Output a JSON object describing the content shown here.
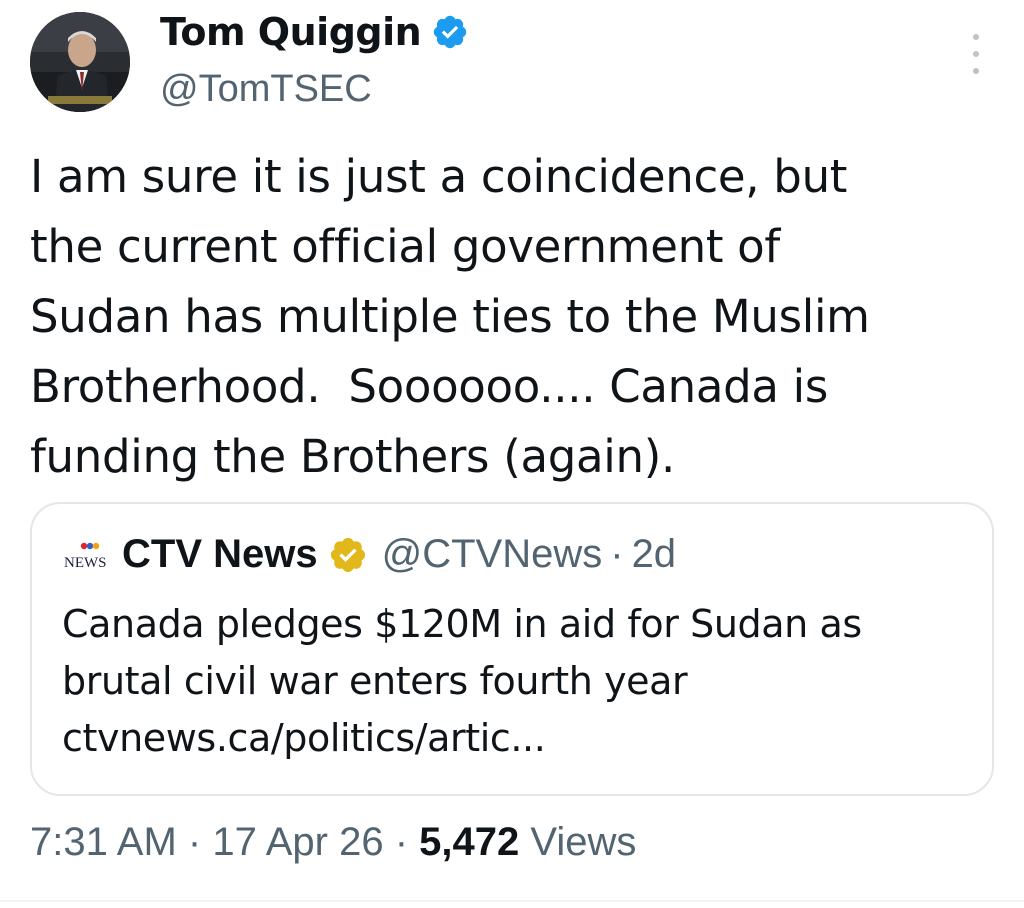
{
  "author": {
    "name": "Tom Quiggin",
    "handle": "@TomTSEC",
    "verified": true
  },
  "tweet": {
    "text": "I am sure it is just a coincidence, but\nthe current official government of\nSudan has multiple ties to the Muslim\nBrotherhood.  Soooooo.... Canada is\nfunding the Brothers (again)."
  },
  "quote": {
    "logo_text": "NEWS",
    "name": "CTV News",
    "handle": "@CTVNews",
    "separator": "·",
    "time": "2d",
    "text": "Canada pledges $120M in aid for Sudan as\nbrutal civil war enters fourth year\nctvnews.ca/politics/artic..."
  },
  "meta": {
    "time": "7:31 AM",
    "sep1": "·",
    "date": "17 Apr 26",
    "sep2": "·",
    "views_count": "5,472",
    "views_label": "Views"
  },
  "colors": {
    "text": "#0f1419",
    "secondary": "#536471",
    "verified_blue": "#1d9bf0",
    "verified_gold": "#e2b719",
    "border": "#e3e7ea"
  },
  "icons": {
    "verified": "verified-badge-icon",
    "gold_verified": "gold-verified-badge-icon",
    "more": "more-options-icon"
  }
}
